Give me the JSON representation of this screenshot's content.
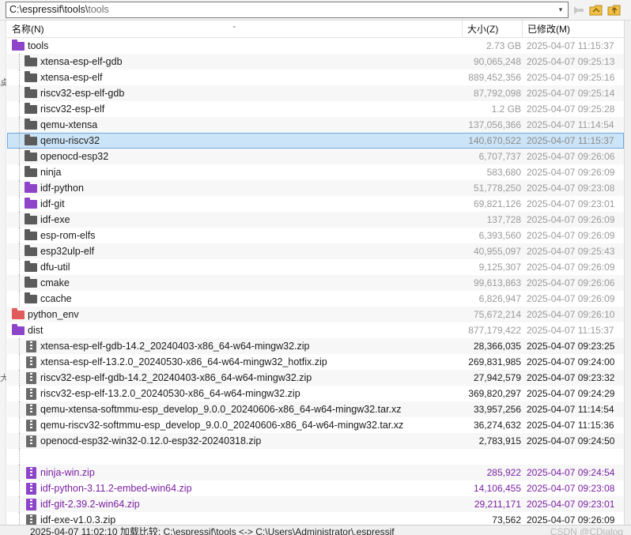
{
  "path_bar": {
    "path_prefix": "C:\\espressif\\tools\\",
    "path_tail": "tools",
    "dropdown_glyph": "▾"
  },
  "gutter_marks": [
    "奌",
    "大"
  ],
  "columns": {
    "name": "名称(N)",
    "size": "大小(Z)",
    "modified": "已修改(M)"
  },
  "rows": [
    {
      "name": "tools",
      "size": "2.73 GB",
      "modified": "2025-04-07 11:15:37",
      "icon": "folder-purple",
      "level": 0,
      "style": "faded"
    },
    {
      "name": "xtensa-esp-elf-gdb",
      "size": "90,065,248",
      "modified": "2025-04-07 09:25:13",
      "icon": "folder-grey",
      "level": 1,
      "style": "faded"
    },
    {
      "name": "xtensa-esp-elf",
      "size": "889,452,356",
      "modified": "2025-04-07 09:25:16",
      "icon": "folder-grey",
      "level": 1,
      "style": "faded"
    },
    {
      "name": "riscv32-esp-elf-gdb",
      "size": "87,792,098",
      "modified": "2025-04-07 09:25:14",
      "icon": "folder-grey",
      "level": 1,
      "style": "faded"
    },
    {
      "name": "riscv32-esp-elf",
      "size": "1.2 GB",
      "modified": "2025-04-07 09:25:28",
      "icon": "folder-grey",
      "level": 1,
      "style": "faded"
    },
    {
      "name": "qemu-xtensa",
      "size": "137,056,366",
      "modified": "2025-04-07 11:14:54",
      "icon": "folder-grey",
      "level": 1,
      "style": "faded"
    },
    {
      "name": "qemu-riscv32",
      "size": "140,670,522",
      "modified": "2025-04-07 11:15:37",
      "icon": "folder-grey",
      "level": 1,
      "style": "selected"
    },
    {
      "name": "openocd-esp32",
      "size": "6,707,737",
      "modified": "2025-04-07 09:26:06",
      "icon": "folder-grey",
      "level": 1,
      "style": "faded"
    },
    {
      "name": "ninja",
      "size": "583,680",
      "modified": "2025-04-07 09:26:09",
      "icon": "folder-grey",
      "level": 1,
      "style": "faded"
    },
    {
      "name": "idf-python",
      "size": "51,778,250",
      "modified": "2025-04-07 09:23:08",
      "icon": "folder-purple",
      "level": 1,
      "style": "faded"
    },
    {
      "name": "idf-git",
      "size": "69,821,126",
      "modified": "2025-04-07 09:23:01",
      "icon": "folder-purple",
      "level": 1,
      "style": "faded"
    },
    {
      "name": "idf-exe",
      "size": "137,728",
      "modified": "2025-04-07 09:26:09",
      "icon": "folder-grey",
      "level": 1,
      "style": "faded"
    },
    {
      "name": "esp-rom-elfs",
      "size": "6,393,560",
      "modified": "2025-04-07 09:26:09",
      "icon": "folder-grey",
      "level": 1,
      "style": "faded"
    },
    {
      "name": "esp32ulp-elf",
      "size": "40,955,097",
      "modified": "2025-04-07 09:25:43",
      "icon": "folder-grey",
      "level": 1,
      "style": "faded"
    },
    {
      "name": "dfu-util",
      "size": "9,125,307",
      "modified": "2025-04-07 09:26:09",
      "icon": "folder-grey",
      "level": 1,
      "style": "faded"
    },
    {
      "name": "cmake",
      "size": "99,613,863",
      "modified": "2025-04-07 09:26:06",
      "icon": "folder-grey",
      "level": 1,
      "style": "faded"
    },
    {
      "name": "ccache",
      "size": "6,826,947",
      "modified": "2025-04-07 09:26:09",
      "icon": "folder-grey",
      "level": 1,
      "style": "faded"
    },
    {
      "name": "python_env",
      "size": "75,672,214",
      "modified": "2025-04-07 09:26:10",
      "icon": "folder-red",
      "level": 0,
      "style": "faded"
    },
    {
      "name": "dist",
      "size": "877,179,422",
      "modified": "2025-04-07 11:15:37",
      "icon": "folder-purple",
      "level": 0,
      "style": "faded"
    },
    {
      "name": "xtensa-esp-elf-gdb-14.2_20240403-x86_64-w64-mingw32.zip",
      "size": "28,366,035",
      "modified": "2025-04-07 09:23:25",
      "icon": "zip-grey",
      "level": 1,
      "style": "dark"
    },
    {
      "name": "xtensa-esp-elf-13.2.0_20240530-x86_64-w64-mingw32_hotfix.zip",
      "size": "269,831,985",
      "modified": "2025-04-07 09:24:00",
      "icon": "zip-grey",
      "level": 1,
      "style": "dark"
    },
    {
      "name": "riscv32-esp-elf-gdb-14.2_20240403-x86_64-w64-mingw32.zip",
      "size": "27,942,579",
      "modified": "2025-04-07 09:23:32",
      "icon": "zip-grey",
      "level": 1,
      "style": "dark"
    },
    {
      "name": "riscv32-esp-elf-13.2.0_20240530-x86_64-w64-mingw32.zip",
      "size": "369,820,297",
      "modified": "2025-04-07 09:24:29",
      "icon": "zip-grey",
      "level": 1,
      "style": "dark"
    },
    {
      "name": "qemu-xtensa-softmmu-esp_develop_9.0.0_20240606-x86_64-w64-mingw32.tar.xz",
      "size": "33,957,256",
      "modified": "2025-04-07 11:14:54",
      "icon": "zip-grey",
      "level": 1,
      "style": "dark"
    },
    {
      "name": "qemu-riscv32-softmmu-esp_develop_9.0.0_20240606-x86_64-w64-mingw32.tar.xz",
      "size": "36,274,632",
      "modified": "2025-04-07 11:15:36",
      "icon": "zip-grey",
      "level": 1,
      "style": "dark"
    },
    {
      "name": "openocd-esp32-win32-0.12.0-esp32-20240318.zip",
      "size": "2,783,915",
      "modified": "2025-04-07 09:24:50",
      "icon": "zip-grey",
      "level": 1,
      "style": "dark"
    },
    {
      "name": "",
      "size": "",
      "modified": "",
      "icon": "none",
      "level": 1,
      "style": "dark"
    },
    {
      "name": "ninja-win.zip",
      "size": "285,922",
      "modified": "2025-04-07 09:24:54",
      "icon": "zip-purple",
      "level": 1,
      "style": "purple"
    },
    {
      "name": "idf-python-3.11.2-embed-win64.zip",
      "size": "14,106,455",
      "modified": "2025-04-07 09:23:08",
      "icon": "zip-purple",
      "level": 1,
      "style": "purple"
    },
    {
      "name": "idf-git-2.39.2-win64.zip",
      "size": "29,211,171",
      "modified": "2025-04-07 09:23:01",
      "icon": "zip-purple",
      "level": 1,
      "style": "purple"
    },
    {
      "name": "idf-exe-v1.0.3.zip",
      "size": "73,562",
      "modified": "2025-04-07 09:26:09",
      "icon": "zip-grey",
      "level": 1,
      "style": "dark"
    }
  ],
  "status": {
    "text": "2025-04-07 11:02:10   加载比较: C:\\espressif\\tools <-> C:\\Users\\Administrator\\.espressif",
    "watermark": "CSDN @CDialog"
  },
  "colors": {
    "selection": "#cce4f7",
    "purple_text": "#7a1fa2",
    "folder_purple": "#8e44c9",
    "folder_red": "#e15a5a",
    "folder_grey": "#5b5b5b"
  }
}
